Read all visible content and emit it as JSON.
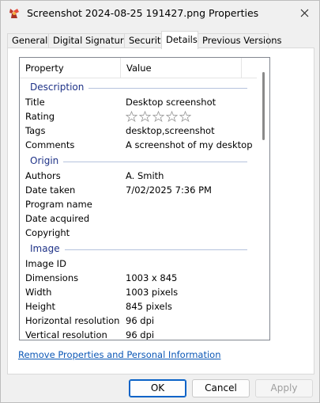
{
  "window": {
    "title": "Screenshot 2024-08-25 191427.png Properties",
    "close_icon": "close-icon"
  },
  "tabs": [
    {
      "label": "General",
      "active": false
    },
    {
      "label": "Digital Signatures",
      "active": false
    },
    {
      "label": "Security",
      "active": false
    },
    {
      "label": "Details",
      "active": true
    },
    {
      "label": "Previous Versions",
      "active": false
    }
  ],
  "list": {
    "col_property": "Property",
    "col_value": "Value",
    "groups": {
      "description": {
        "label": "Description",
        "title_key": "Title",
        "title_val": "Desktop screenshot",
        "rating_key": "Rating",
        "rating_value": 0,
        "rating_max": 5,
        "tags_key": "Tags",
        "tags_val": "desktop,screenshot",
        "comments_key": "Comments",
        "comments_val": "A screenshot of my desktop"
      },
      "origin": {
        "label": "Origin",
        "authors_key": "Authors",
        "authors_val": "A. Smith",
        "date_taken_key": "Date taken",
        "date_taken_val": "7/02/2025 7:36 PM",
        "program_key": "Program name",
        "program_val": "",
        "acquired_key": "Date acquired",
        "acquired_val": "",
        "copyright_key": "Copyright",
        "copyright_val": ""
      },
      "image": {
        "label": "Image",
        "id_key": "Image ID",
        "id_val": "",
        "dimensions_key": "Dimensions",
        "dimensions_val": "1003 x 845",
        "width_key": "Width",
        "width_val": "1003 pixels",
        "height_key": "Height",
        "height_val": "845 pixels",
        "hres_key": "Horizontal resolution",
        "hres_val": "96 dpi",
        "vres_key": "Vertical resolution",
        "vres_val": "96 dpi"
      }
    }
  },
  "link_text": "Remove Properties and Personal Information",
  "buttons": {
    "ok": "OK",
    "cancel": "Cancel",
    "apply": "Apply"
  },
  "colors": {
    "group_header": "#1e3287",
    "link": "#0b57b6",
    "default_button_border": "#0b63c7"
  }
}
